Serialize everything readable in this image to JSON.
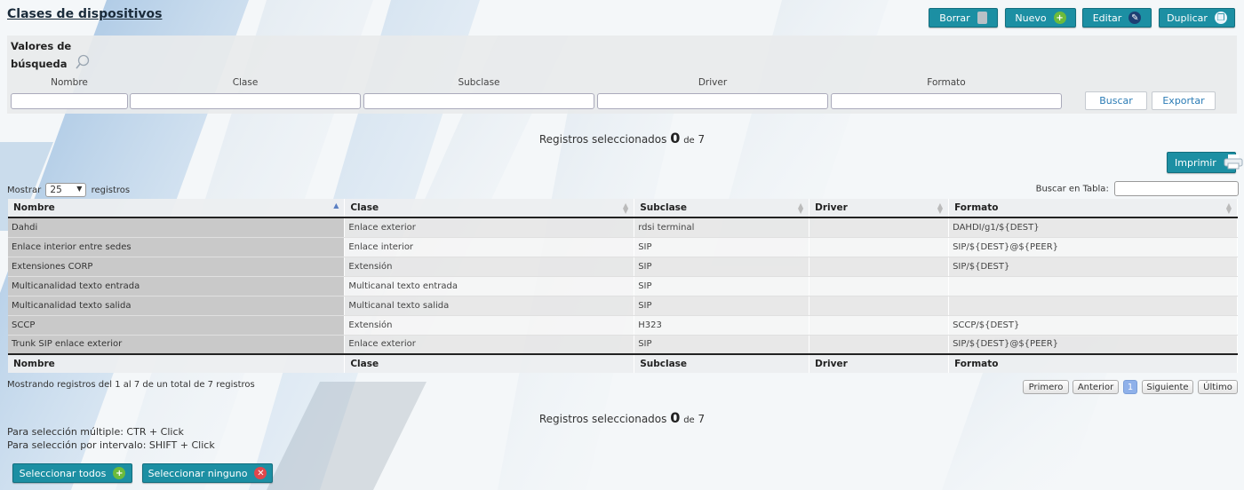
{
  "page": {
    "title": "Clases de dispositivos"
  },
  "toolbar": {
    "delete_label": "Borrar",
    "new_label": "Nuevo",
    "edit_label": "Editar",
    "duplicate_label": "Duplicar"
  },
  "search": {
    "title_line1": "Valores de",
    "title_line2": "búsqueda",
    "columns": [
      "Nombre",
      "Clase",
      "Subclase",
      "Driver",
      "Formato"
    ],
    "values": [
      "",
      "",
      "",
      "",
      ""
    ],
    "search_button": "Buscar",
    "export_button": "Exportar"
  },
  "selection": {
    "prefix": "Registros seleccionados",
    "count": "0",
    "of": "de",
    "total": "7"
  },
  "print_button": "Imprimir",
  "table_controls": {
    "show_label": "Mostrar",
    "page_length": "25",
    "records_label": "registros",
    "search_label": "Buscar en Tabla:"
  },
  "table": {
    "columns": [
      "Nombre",
      "Clase",
      "Subclase",
      "Driver",
      "Formato"
    ],
    "rows": [
      [
        "Dahdi",
        "Enlace exterior",
        "rdsi terminal",
        "",
        "DAHDI/g1/${DEST}"
      ],
      [
        "Enlace interior entre sedes",
        "Enlace interior",
        "SIP",
        "",
        "SIP/${DEST}@${PEER}"
      ],
      [
        "Extensiones CORP",
        "Extensión",
        "SIP",
        "",
        "SIP/${DEST}"
      ],
      [
        "Multicanalidad texto entrada",
        "Multicanal texto entrada",
        "SIP",
        "",
        ""
      ],
      [
        "Multicanalidad texto salida",
        "Multicanal texto salida",
        "SIP",
        "",
        ""
      ],
      [
        "SCCP",
        "Extensión",
        "H323",
        "",
        "SCCP/${DEST}"
      ],
      [
        "Trunk SIP enlace exterior",
        "Enlace exterior",
        "SIP",
        "",
        "SIP/${DEST}@${PEER}"
      ]
    ],
    "info": "Mostrando registros del 1 al 7 de un total de 7 registros"
  },
  "pagination": {
    "first": "Primero",
    "previous": "Anterior",
    "current": "1",
    "next": "Siguiente",
    "last": "Último"
  },
  "hints": {
    "multi": "Para selección múltiple: CTR + Click",
    "range": "Para selección por intervalo: SHIFT + Click"
  },
  "bottom_buttons": {
    "select_all": "Seleccionar todos",
    "select_none": "Seleccionar ninguno"
  },
  "colors": {
    "accent": "#1c8fa3",
    "panel": "#e8eaec",
    "pager_current": "#8fb1ea"
  }
}
